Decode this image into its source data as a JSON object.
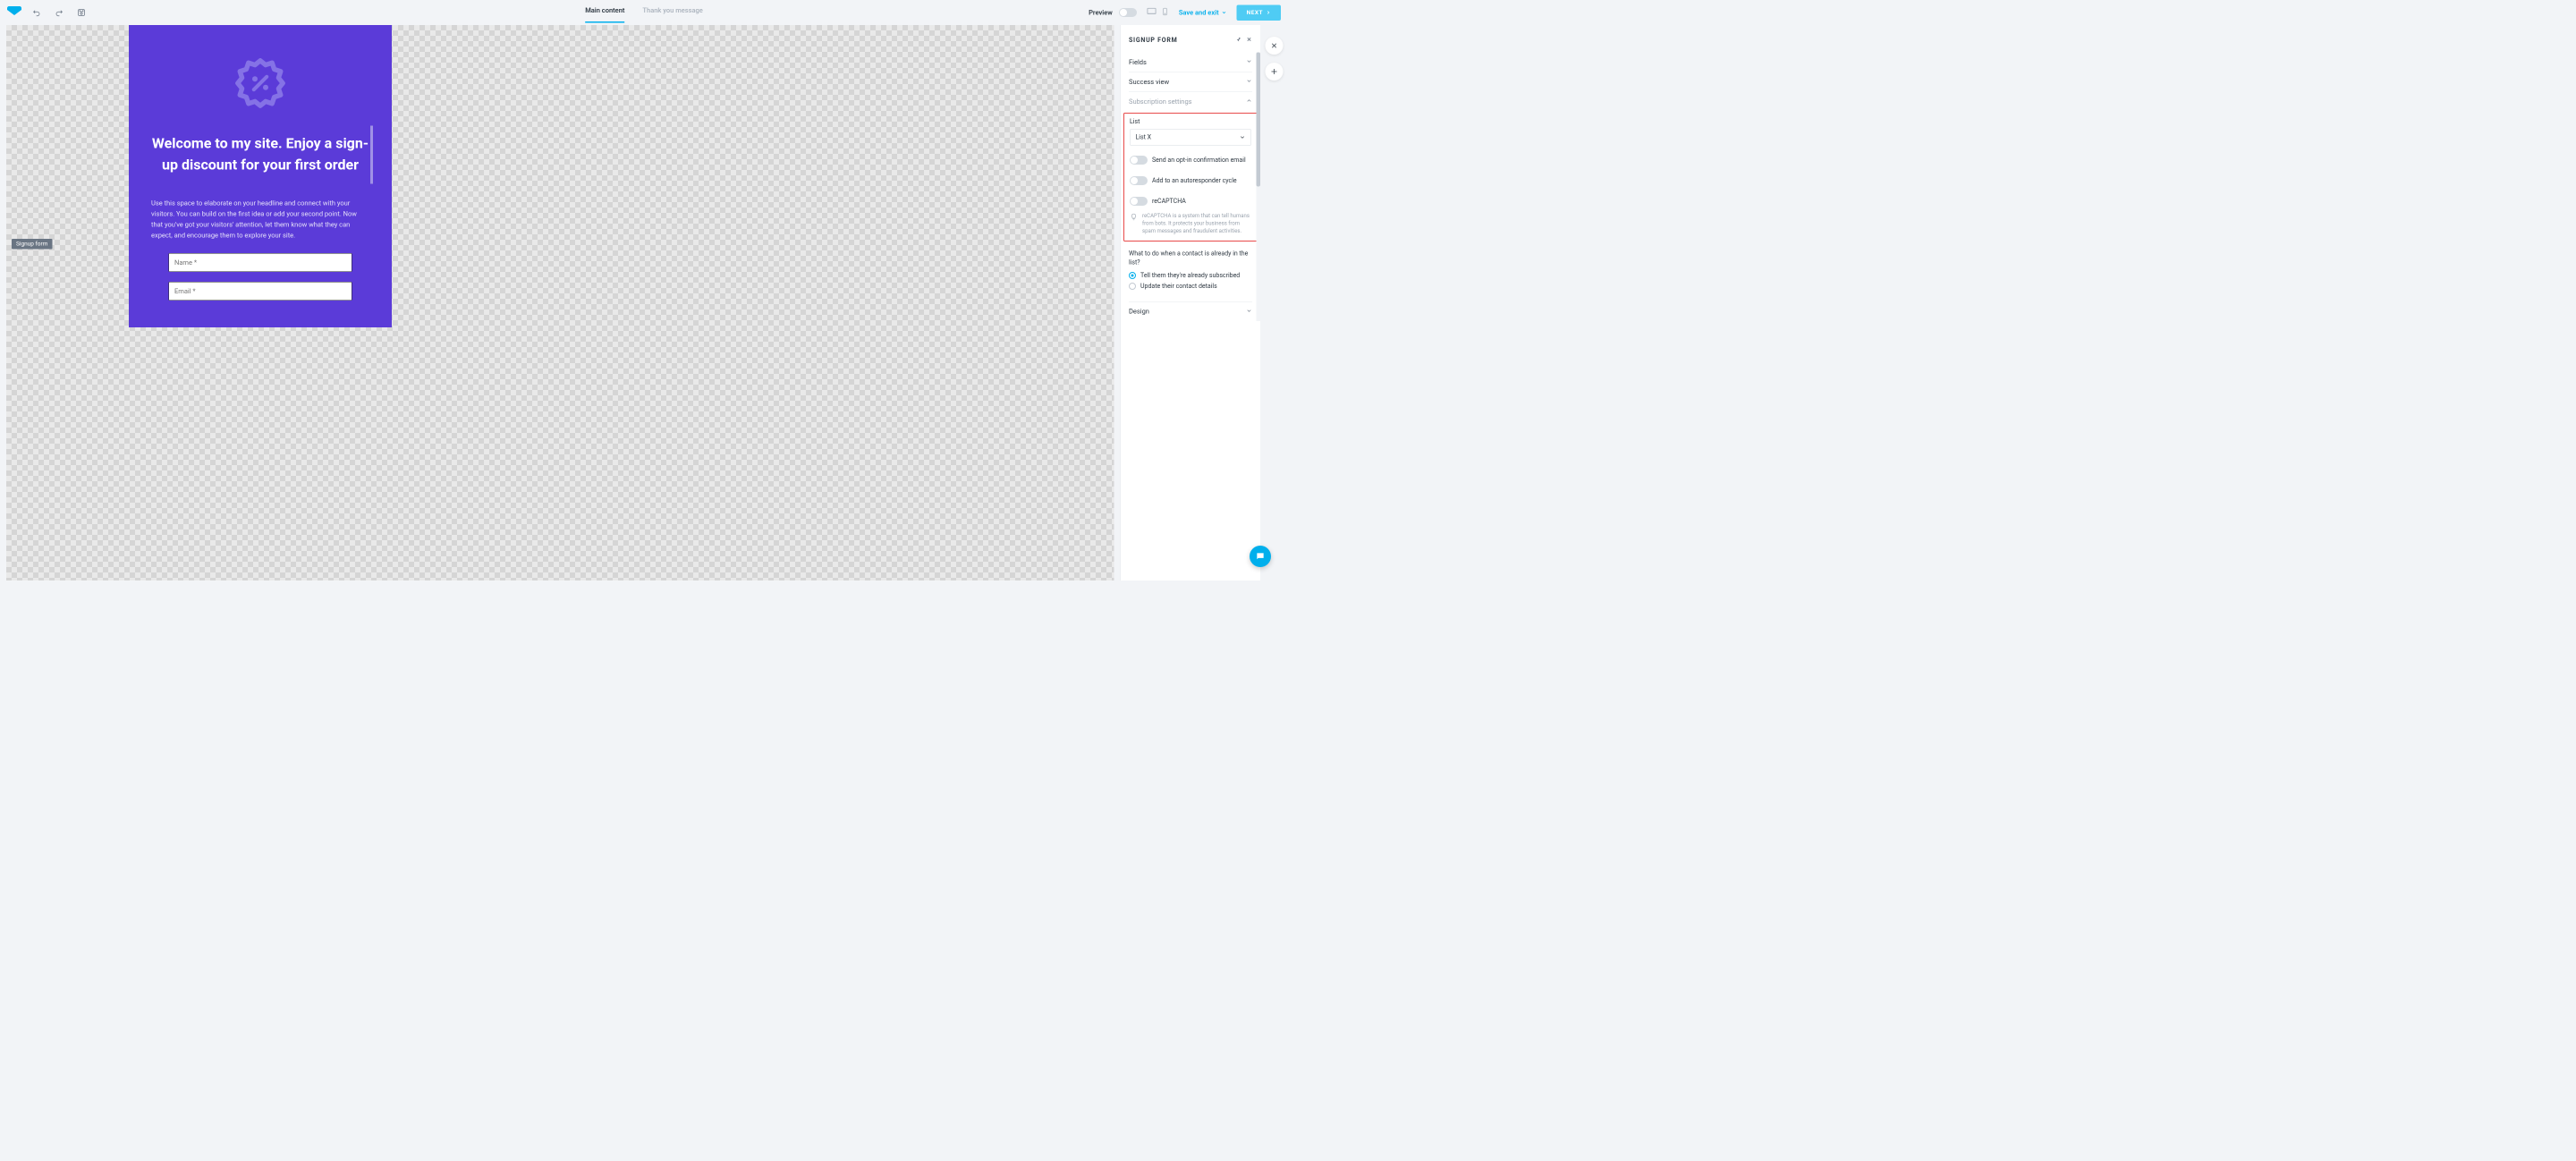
{
  "topbar": {
    "tabs": [
      {
        "label": "Main content",
        "active": true
      },
      {
        "label": "Thank you message",
        "active": false
      }
    ],
    "preview_label": "Preview",
    "save_exit_label": "Save and exit",
    "next_label": "NEXT"
  },
  "canvas": {
    "headline": "Welcome to my site. Enjoy a sign-up discount for your first order",
    "description": "Use this space to elaborate on your headline and connect with your visitors. You can build on the first idea or add your second point. Now that you've got your visitors' attention, let them know what they can expect, and encourage them to explore your site.",
    "badge_label": "Signup form",
    "fields": {
      "name_placeholder": "Name *",
      "email_placeholder": "Email *"
    }
  },
  "panel": {
    "title": "SIGNUP FORM",
    "sections": {
      "fields": "Fields",
      "success_view": "Success view",
      "subscription_settings": "Subscription settings",
      "design": "Design"
    },
    "subscription": {
      "list_label": "List",
      "list_value": "List X",
      "opt_in_label": "Send an opt-in confirmation email",
      "autoresponder_label": "Add to an autoresponder cycle",
      "recaptcha_label": "reCAPTCHA",
      "recaptcha_hint": "reCAPTCHA is a system that can tell humans from bots. It protects your business from spam messages and fraudulent activities.",
      "existing_question": "What to do when a contact is already in the list?",
      "existing_opt1": "Tell them they're already subscribed",
      "existing_opt2": "Update their contact details"
    }
  }
}
